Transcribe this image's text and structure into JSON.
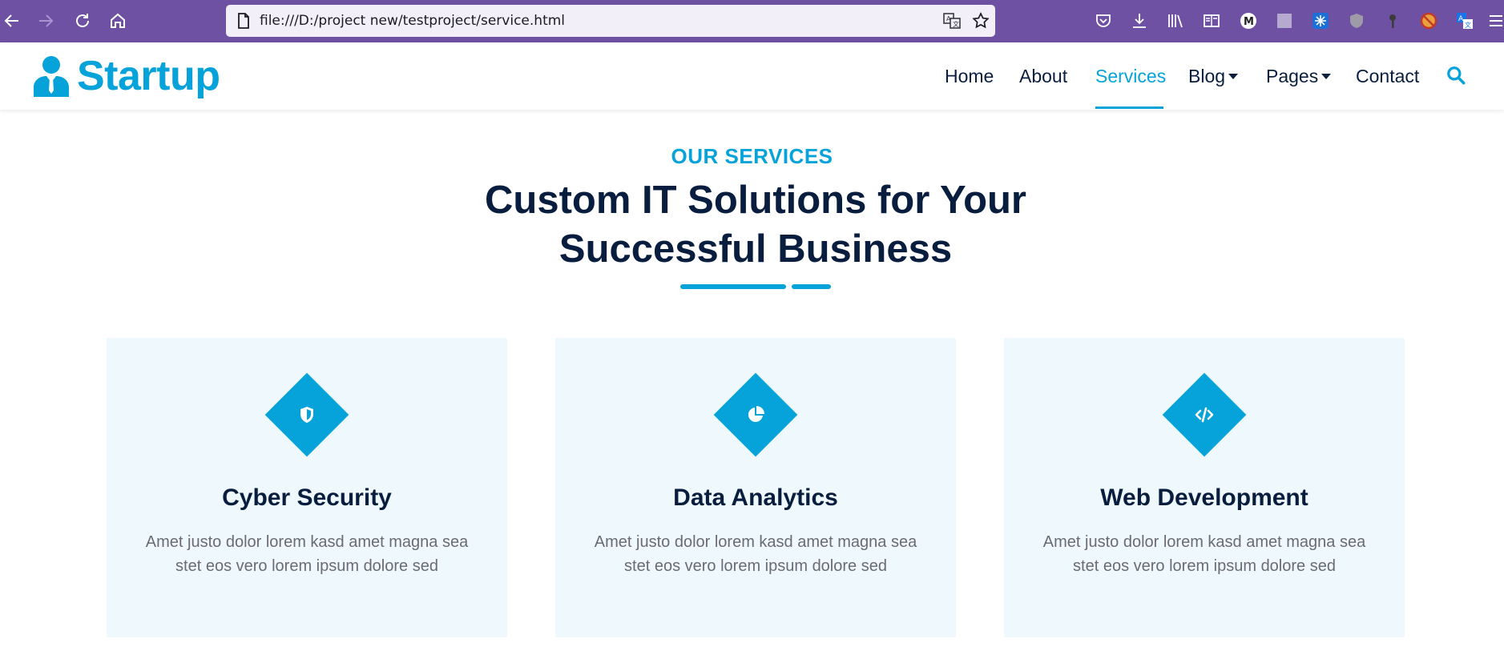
{
  "browser": {
    "url": "file:///D:/project new/testproject/service.html",
    "icons": [
      "back-icon",
      "forward-icon",
      "reload-icon",
      "home-icon",
      "page-icon",
      "translate-icon",
      "bookmark-star-icon",
      "pocket-icon",
      "download-icon",
      "library-icon",
      "reader-view-icon",
      "extension-m-icon",
      "extension-square-icon",
      "extension-snowflake-icon",
      "extension-shield-icon",
      "extension-key-icon",
      "extension-blocker-icon",
      "extension-translate-icon",
      "menu-icon"
    ]
  },
  "site": {
    "brand": "Startup",
    "nav": {
      "home": "Home",
      "about": "About",
      "services": "Services",
      "blog": "Blog",
      "pages": "Pages",
      "contact": "Contact"
    },
    "colors": {
      "primary": "#06a3da",
      "dark": "#091e3e",
      "card_bg": "#eef8fd"
    }
  },
  "section": {
    "eyebrow": "OUR SERVICES",
    "heading_line1": "Custom IT Solutions for Your",
    "heading_line2": "Successful Business"
  },
  "services": [
    {
      "title": "Cyber Security",
      "desc_line1": "Amet justo dolor lorem kasd amet magna sea",
      "desc_line2": "stet eos vero lorem ipsum dolore sed",
      "icon": "shield-icon"
    },
    {
      "title": "Data Analytics",
      "desc_line1": "Amet justo dolor lorem kasd amet magna sea",
      "desc_line2": "stet eos vero lorem ipsum dolore sed",
      "icon": "pie-chart-icon"
    },
    {
      "title": "Web Development",
      "desc_line1": "Amet justo dolor lorem kasd amet magna sea",
      "desc_line2": "stet eos vero lorem ipsum dolore sed",
      "icon": "code-icon"
    }
  ]
}
